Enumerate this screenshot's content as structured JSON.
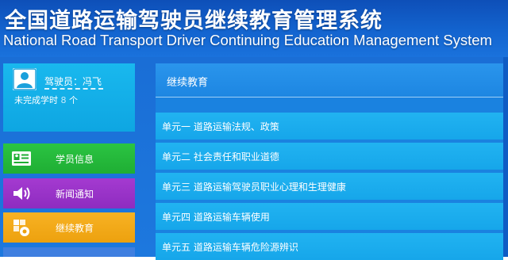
{
  "header": {
    "title_cn": "全国道路运输驾驶员继续教育管理系统",
    "title_en": "National Road Transport Driver Continuing Education Management System"
  },
  "user": {
    "name_label": "驾驶员：冯飞",
    "incomplete_label": "未完成学时",
    "incomplete_count": "8",
    "incomplete_unit": "个"
  },
  "nav": {
    "items": [
      {
        "label": "学员信息",
        "icon": "id-card-icon",
        "color": "#2bc442"
      },
      {
        "label": "新闻通知",
        "icon": "speaker-icon",
        "color": "#a43ad0"
      },
      {
        "label": "继续教育",
        "icon": "education-icon",
        "color": "#f7b224"
      }
    ]
  },
  "content": {
    "title": "继续教育",
    "units": [
      "单元一   道路运输法规、政策",
      "单元二   社会责任和职业道德",
      "单元三   道路运输驾驶员职业心理和生理健康",
      "单元四   道路运输车辆使用",
      "单元五   道路运输车辆危险源辨识"
    ]
  },
  "colors": {
    "header_bg": "#1364cf",
    "user_card_bg": "#19b8ee",
    "unit_row_bg": "#21b3f1"
  }
}
